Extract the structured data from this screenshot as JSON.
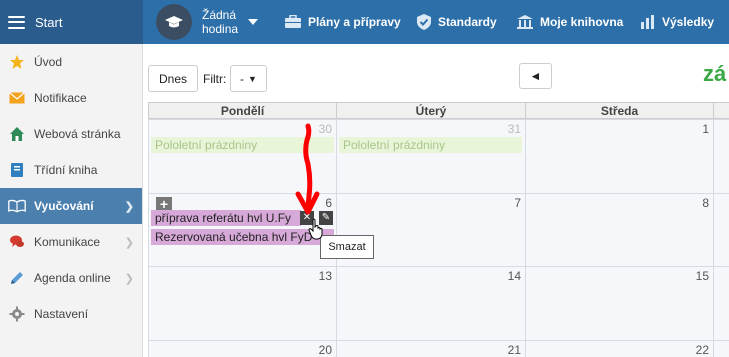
{
  "topbar": {
    "start_label": "Start",
    "hour_label": "Žádná hodina",
    "nav": [
      {
        "label": "Plány a přípravy",
        "icon": "briefcase-icon"
      },
      {
        "label": "Standardy",
        "icon": "shield-check-icon"
      },
      {
        "label": "Moje knihovna",
        "icon": "library-icon"
      },
      {
        "label": "Výsledky",
        "icon": "bar-chart-icon"
      }
    ]
  },
  "sidebar": {
    "items": [
      {
        "label": "Úvod",
        "icon": "star-icon"
      },
      {
        "label": "Notifikace",
        "icon": "envelope-icon"
      },
      {
        "label": "Webová stránka",
        "icon": "home-icon"
      },
      {
        "label": "Třídní kniha",
        "icon": "book-icon"
      },
      {
        "label": "Vyučování",
        "icon": "open-book-icon",
        "active": true
      },
      {
        "label": "Komunikace",
        "icon": "chat-icon"
      },
      {
        "label": "Agenda online",
        "icon": "pencil-icon"
      },
      {
        "label": "Nastavení",
        "icon": "gear-icon"
      }
    ]
  },
  "toolbar": {
    "today_label": "Dnes",
    "filter_label": "Filtr:",
    "filter_value": "-",
    "prev_symbol": "◄",
    "title_fragment": "zá"
  },
  "calendar": {
    "headers": [
      "Pondělí",
      "Úterý",
      "Středa"
    ],
    "days": {
      "r1": [
        "30",
        "31",
        "1"
      ],
      "r2": [
        "6",
        "7",
        "8"
      ],
      "r3": [
        "13",
        "14",
        "15"
      ],
      "r4": [
        "20",
        "21",
        "22"
      ]
    },
    "holiday_label": "Pololetní prázdniny",
    "events": [
      "příprava referátu hvl U.Fy",
      "Rezervovaná učebna hvl FyD"
    ],
    "tooltip": "Smazat"
  },
  "colors": {
    "topbar": "#2d6fa8",
    "sidebar_active": "#4a7fae",
    "title_green": "#3aa845",
    "event": "#d7a9d9",
    "holiday": "#e9f5d8",
    "annotation": "#ff0000"
  }
}
